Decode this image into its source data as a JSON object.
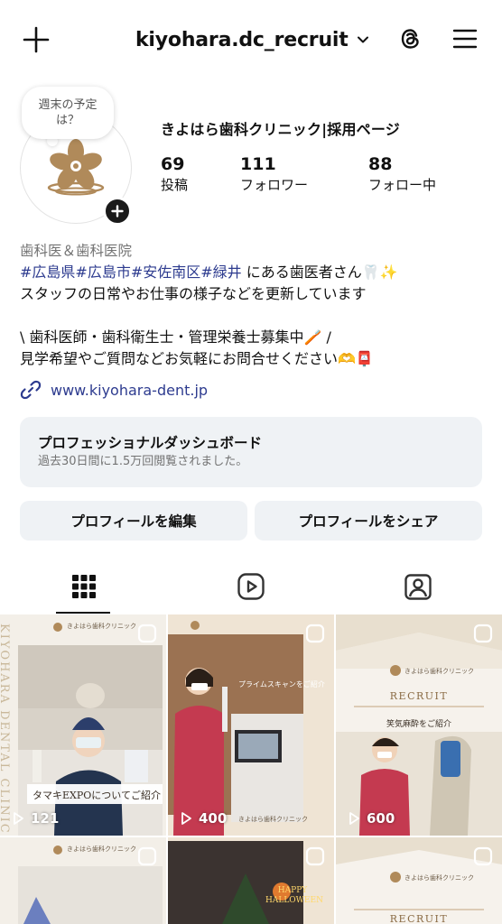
{
  "header": {
    "username": "kiyohara.dc_recruit",
    "icons": {
      "create": "plus-icon",
      "switch": "chevron-down-icon",
      "threads": "threads-icon",
      "menu": "hamburger-menu-icon"
    }
  },
  "profile": {
    "note": "週末の予定は？",
    "display_name": "きよはら歯科クリニック|採用ページ",
    "stats": [
      {
        "num": "69",
        "label": "投稿"
      },
      {
        "num": "111",
        "label": "フォロワー"
      },
      {
        "num": "88",
        "label": "フォロー中"
      }
    ]
  },
  "bio": {
    "category": "歯科医＆歯科医院",
    "hashtags": [
      "#広島県",
      "#広島市",
      "#安佐南区",
      "#緑井"
    ],
    "line1_suffix": " にある歯医者さん🦷✨",
    "line2": "スタッフの日常やお仕事の様子などを更新しています",
    "line3": "\\ 歯科医師・歯科衛生士・管理栄養士募集中🪥 /",
    "line4": "見学希望やご質問などお気軽にお問合せください🫶📮",
    "link": "www.kiyohara-dent.jp"
  },
  "dashboard": {
    "title": "プロフェッショナルダッシュボード",
    "subtitle": "過去30日間に1.5万回閲覧されました。"
  },
  "buttons": {
    "edit": "プロフィールを編集",
    "share": "プロフィールをシェア"
  },
  "tabs": [
    {
      "name": "posts",
      "icon": "grid-icon",
      "active": true
    },
    {
      "name": "reels",
      "icon": "reels-icon",
      "active": false
    },
    {
      "name": "tagged",
      "icon": "tagged-icon",
      "active": false
    }
  ],
  "posts": [
    {
      "views": "121",
      "caption": "タマキEXPOについてご紹介",
      "clinic": "きよはら歯科クリニック"
    },
    {
      "views": "400",
      "caption": "プライムスキャンをご紹介",
      "clinic": "きよはら歯科クリニック"
    },
    {
      "views": "600",
      "caption": "笑気麻酔をご紹介",
      "title": "RECRUIT",
      "clinic": "きよはら歯科クリニック"
    },
    {
      "views": "",
      "caption": "",
      "clinic": "きよはら歯科クリニック"
    },
    {
      "views": "",
      "caption": "HAPPY HALLOWEEN",
      "clinic": ""
    },
    {
      "views": "",
      "caption": "",
      "title": "RECRUIT",
      "clinic": "きよはら歯科クリニック"
    }
  ],
  "side_text": "KIYOHARA DENTAL CLINIC",
  "colors": {
    "link": "#2d3b8f",
    "button_bg": "#eff2f5",
    "brand_gold": "#b08a5a"
  }
}
